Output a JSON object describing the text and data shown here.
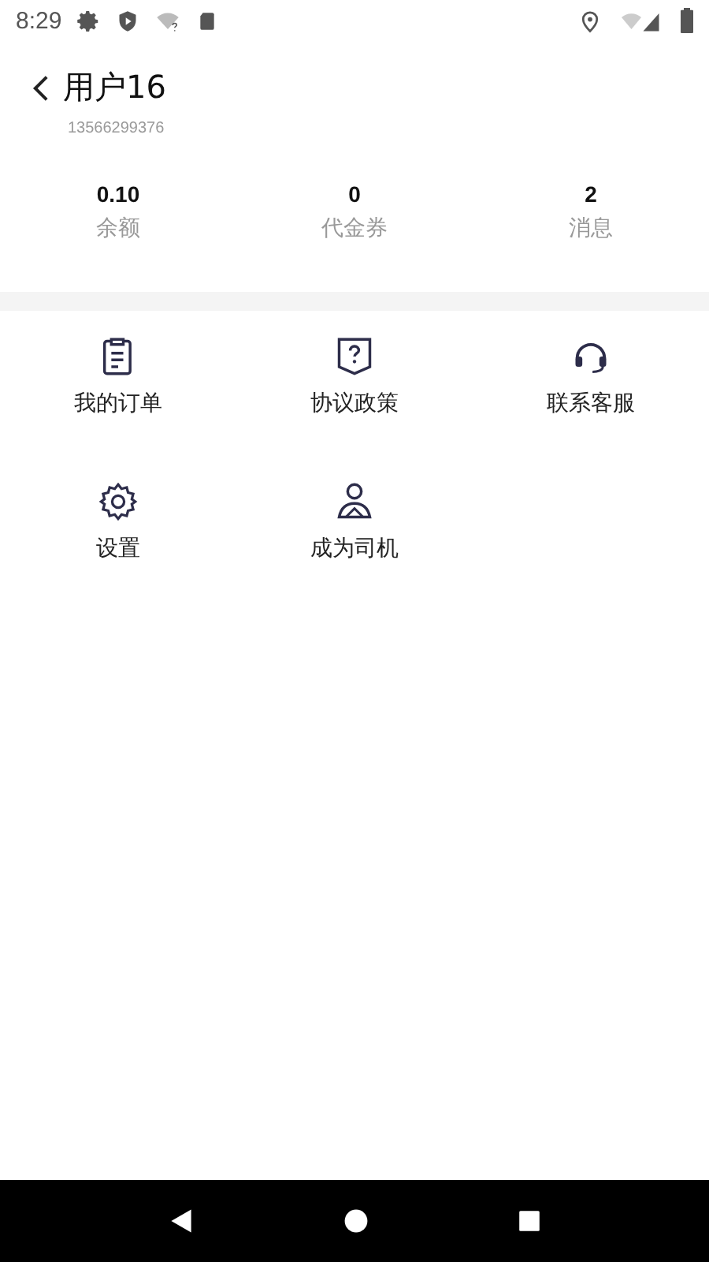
{
  "status_bar": {
    "time": "8:29"
  },
  "header": {
    "title": "用户16",
    "phone": "13566299376"
  },
  "stats": [
    {
      "value": "0.10",
      "label": "余额"
    },
    {
      "value": "0",
      "label": "代金券"
    },
    {
      "value": "2",
      "label": "消息"
    }
  ],
  "menu": [
    {
      "kind": "orders",
      "label": "我的订单"
    },
    {
      "kind": "policy",
      "label": "协议政策"
    },
    {
      "kind": "support",
      "label": "联系客服"
    },
    {
      "kind": "settings",
      "label": "设置"
    },
    {
      "kind": "driver",
      "label": "成为司机"
    }
  ]
}
